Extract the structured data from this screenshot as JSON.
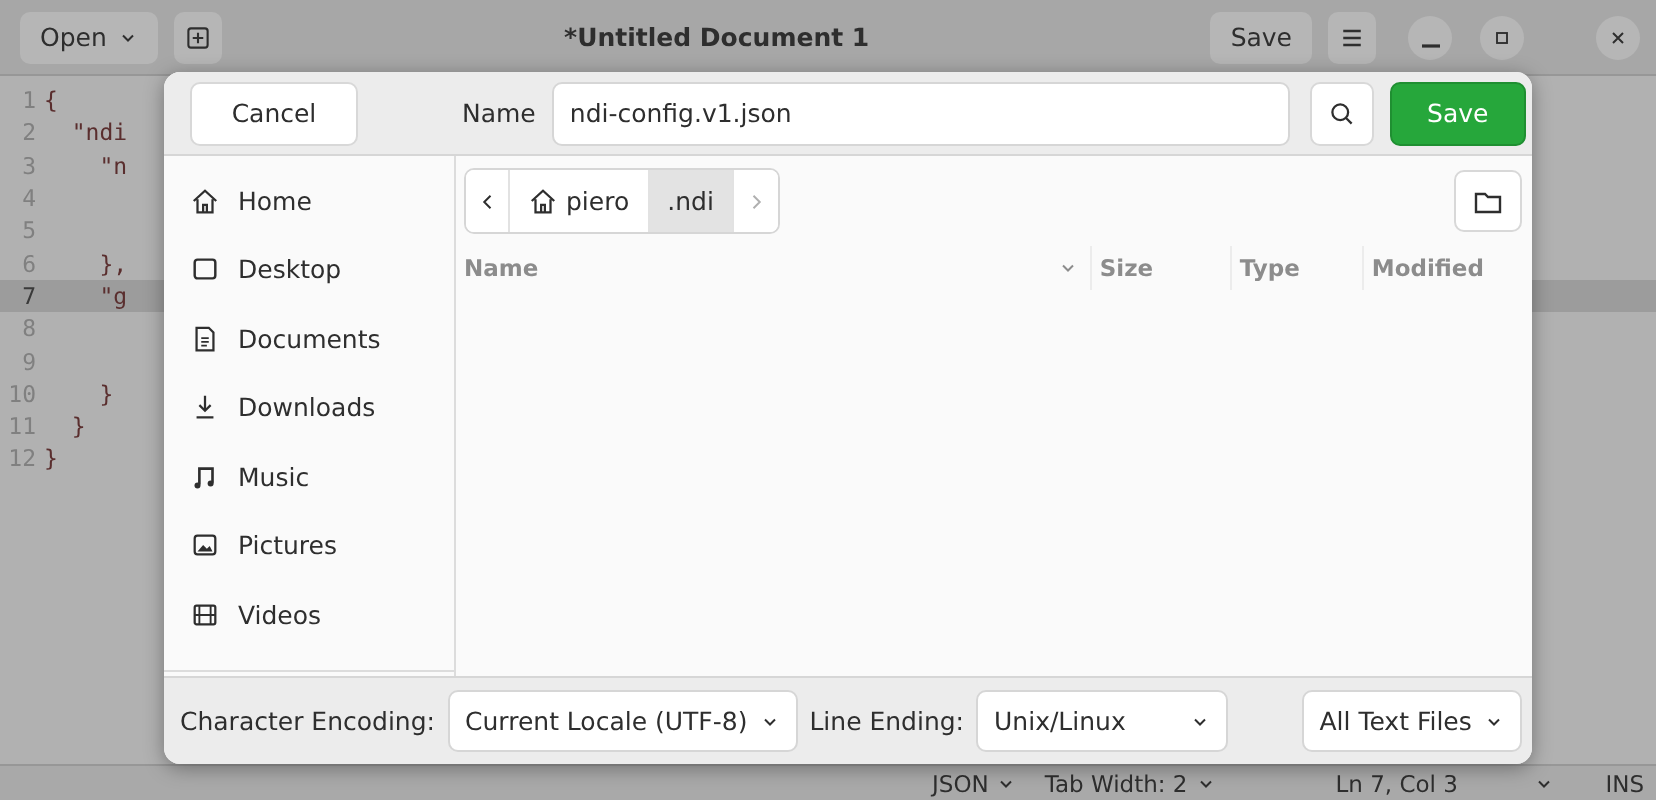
{
  "editor_window": {
    "open_button": "Open",
    "title": "*Untitled Document 1",
    "save_button": "Save"
  },
  "code_lines": [
    {
      "number": "1",
      "text": "{",
      "current": false
    },
    {
      "number": "2",
      "text": "  \"ndi",
      "current": false
    },
    {
      "number": "3",
      "text": "    \"n",
      "current": false
    },
    {
      "number": "4",
      "current": false
    },
    {
      "number": "5",
      "current": false
    },
    {
      "number": "6",
      "text": "    },",
      "current": false
    },
    {
      "number": "7",
      "text": "    \"g",
      "current": true
    },
    {
      "number": "8",
      "current": false
    },
    {
      "number": "9",
      "current": false
    },
    {
      "number": "10",
      "text": "    }",
      "current": false
    },
    {
      "number": "11",
      "text": "  }",
      "current": false
    },
    {
      "number": "12",
      "text": "}",
      "current": false
    }
  ],
  "status_bar": {
    "language": "JSON",
    "tab_width": "Tab Width: 2",
    "position": "Ln 7, Col 3",
    "mode": "INS"
  },
  "dialog": {
    "cancel_button": "Cancel",
    "name_label": "Name",
    "file_name": "ndi-config.v1.json",
    "save_button": "Save",
    "places": [
      {
        "label": "Home",
        "kind": "home"
      },
      {
        "label": "Desktop",
        "kind": "desktop"
      },
      {
        "label": "Documents",
        "kind": "documents"
      },
      {
        "label": "Downloads",
        "kind": "downloads"
      },
      {
        "label": "Music",
        "kind": "music"
      },
      {
        "label": "Pictures",
        "kind": "pictures"
      },
      {
        "label": "Videos",
        "kind": "videos"
      }
    ],
    "path": [
      {
        "label": "piero",
        "kind": "home",
        "selected": false
      },
      {
        "label": ".ndi",
        "kind": "folder",
        "selected": true
      }
    ],
    "columns": [
      "Name",
      "Size",
      "Type",
      "Modified"
    ],
    "encoding_label": "Character Encoding:",
    "encoding": "Current Locale (UTF-8)",
    "line_ending_label": "Line Ending:",
    "line_ending": "Unix/Linux",
    "filter": "All Text Files"
  }
}
